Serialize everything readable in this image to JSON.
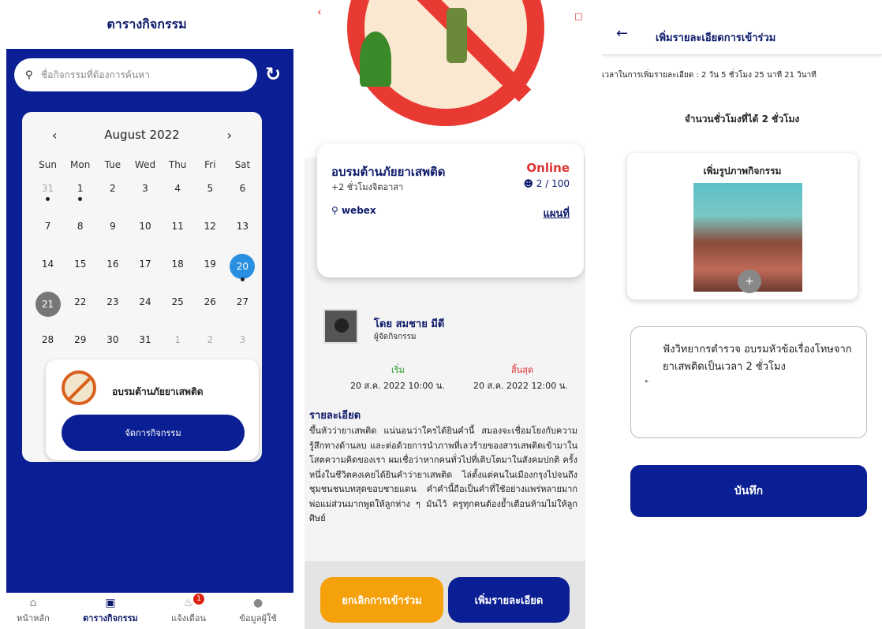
{
  "schedule": {
    "header": "ตารางกิจกรรม",
    "search_placeholder": "ชื่อกิจกรรมที่ต้องการค้นหา",
    "search_icon": "search-icon",
    "refresh_icon": "refresh-icon",
    "calendar": {
      "month_label": "August 2022",
      "prev": "‹",
      "next": "›",
      "weekdays": [
        "Sun",
        "Mon",
        "Tue",
        "Wed",
        "Thu",
        "Fri",
        "Sat"
      ],
      "weeks": [
        [
          "31",
          "1",
          "2",
          "3",
          "4",
          "5",
          "6"
        ],
        [
          "7",
          "8",
          "9",
          "10",
          "11",
          "12",
          "13"
        ],
        [
          "14",
          "15",
          "16",
          "17",
          "18",
          "19",
          "20"
        ],
        [
          "21",
          "22",
          "23",
          "24",
          "25",
          "26",
          "27"
        ],
        [
          "28",
          "29",
          "30",
          "31",
          "1",
          "2",
          "3"
        ]
      ],
      "selected_day": "20",
      "today": "21",
      "event_dots": [
        "31",
        "1",
        "20"
      ]
    },
    "event_card": {
      "title": "อบรมต้านภัยยาเสพติด",
      "manage_button": "จัดการกิจกรรม"
    },
    "tabs": [
      {
        "label": "หน้าหลัก",
        "icon": "home-icon"
      },
      {
        "label": "ตารางกิจกรรม",
        "icon": "calendar-icon"
      },
      {
        "label": "แจ้งเตือน",
        "icon": "bell-icon",
        "badge": "1"
      },
      {
        "label": "ข้อมูลผู้ใช้",
        "icon": "user-icon"
      }
    ]
  },
  "detail": {
    "title": "อบรมต้านภัยยาเสพติด",
    "mode": "Online",
    "hours": "+2 ชั่วโมงจิตอาสา",
    "participants": "2 / 100",
    "location": "webex",
    "map_link": "แผนที่",
    "organizer_name": "โดย สมชาย มีดี",
    "organizer_role": "ผู้จัดกิจกรรม",
    "start_label": "เริ่ม",
    "end_label": "สิ้นสุด",
    "start_value": "20 ส.ค. 2022 10:00 น.",
    "end_value": "20 ส.ค. 2022 12:00 น.",
    "details_heading": "รายละเอียด",
    "details_body": "ขึ้นหัวว่ายาเสพติด แน่นอนว่าใครได้ยินคำนี้ สมองจะเชื่อมโยงกับความรู้สึกทางด้านลบ และต่อด้วยการนำภาพที่เลวร้ายของสารเสพติดเข้ามาในโสตความคิดของเรา ผมเชื่อว่าหากคนทั่วไปที่เติบโตมาในสังคมปกติ ครั้งหนึ่งในชีวิตคงเคยได้ยินคำว่ายาเสพติด ไล่ตั้งแต่คนในเมืองกรุงไปจนถึงชุมชนชนบทสุดขอบชายแดน คำคำนี้ถือเป็นคำที่ใช้อย่างแพร่หลายมาก พ่อแม่ส่วนมากพูดให้ลูกห่าง ๆ มันไว้ ครูทุกคนต้องย้ำเตือนห้ามไม่ให้ลูกศิษย์",
    "cancel_button": "ยกเลิกการเข้าร่วม",
    "add_button": "เพิ่มรายละเอียด"
  },
  "add_detail": {
    "title": "เพิ่มรายละเอียดการเข้าร่วม",
    "time_text": "เวลาในการเพิ่มรายละเอียด : 2 วัน 5 ชั่วโมง 25 นาที 21 วินาที",
    "hours_text": "จำนวนชั่วโมงที่ได้ 2 ชั่วโมง",
    "photo_title": "เพิ่มรูปภาพกิจกรรม",
    "description": "ฟังวิทยากรตำรวจ อบรมหัวข้อเรื่องโทษจากยาเสพติดเป็นเวลา 2 ชั่วโมง",
    "save_button": "บันทึก"
  },
  "colors": {
    "primary": "#0a1f93",
    "accent": "#2a8fe0",
    "danger": "#e83a32",
    "warning": "#f5a10c"
  }
}
